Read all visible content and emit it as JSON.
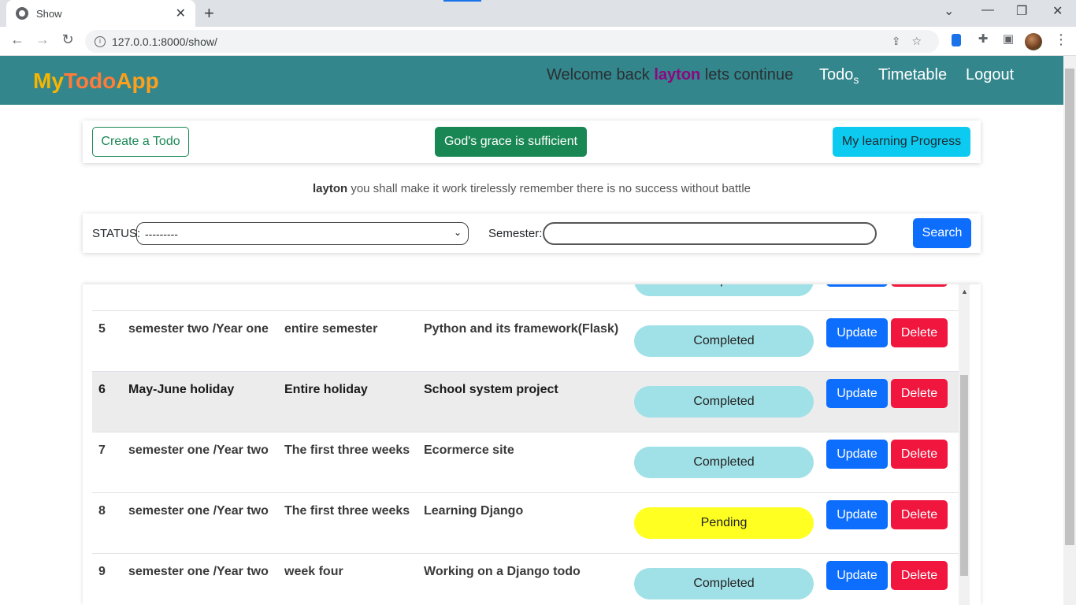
{
  "browser": {
    "tab_title": "Show",
    "tab_close": "✕",
    "new_tab": "+",
    "url": "127.0.0.1:8000/show/"
  },
  "navbar": {
    "brand_my": "My",
    "brand_todo": "Todo",
    "brand_app": "App",
    "welcome_pre": "Welcome back",
    "welcome_user": "layton",
    "welcome_post": "lets continue",
    "link_todos": "Todo",
    "link_todos_sub": "s",
    "link_timetable": "Timetable",
    "link_logout": "Logout"
  },
  "actions": {
    "create": "Create a Todo",
    "grace": "God's grace is sufficient",
    "progress": "My learning Progress"
  },
  "motto": {
    "user": "layton",
    "text": "you shall make it work tirelessly remember there is no success without battle"
  },
  "filter": {
    "status_label": "STATUS:",
    "status_value": "---------",
    "semester_label": "Semester:",
    "semester_value": "",
    "search_label": "Search"
  },
  "table": {
    "partial_status": "Completed",
    "update_label": "Update",
    "delete_label": "Delete",
    "rows": [
      {
        "id": "5",
        "semester": "semester two /Year one",
        "period": "entire semester",
        "task": "Python and its framework(Flask)",
        "status": "Completed"
      },
      {
        "id": "6",
        "semester": "May-June holiday",
        "period": "Entire holiday",
        "task": "School system project",
        "status": "Completed"
      },
      {
        "id": "7",
        "semester": "semester one /Year two",
        "period": "The first three weeks",
        "task": "Ecormerce site",
        "status": "Completed"
      },
      {
        "id": "8",
        "semester": "semester one /Year two",
        "period": "The first three weeks",
        "task": "Learning Django",
        "status": "Pending"
      },
      {
        "id": "9",
        "semester": "semester one /Year two",
        "period": "week four",
        "task": "Working on a Django todo",
        "status": "Completed"
      }
    ]
  },
  "colors": {
    "navbar": "#33868b",
    "completed": "#a0e1e7",
    "pending": "#ffff22",
    "update": "#0d6efd",
    "delete": "#f0163e"
  }
}
